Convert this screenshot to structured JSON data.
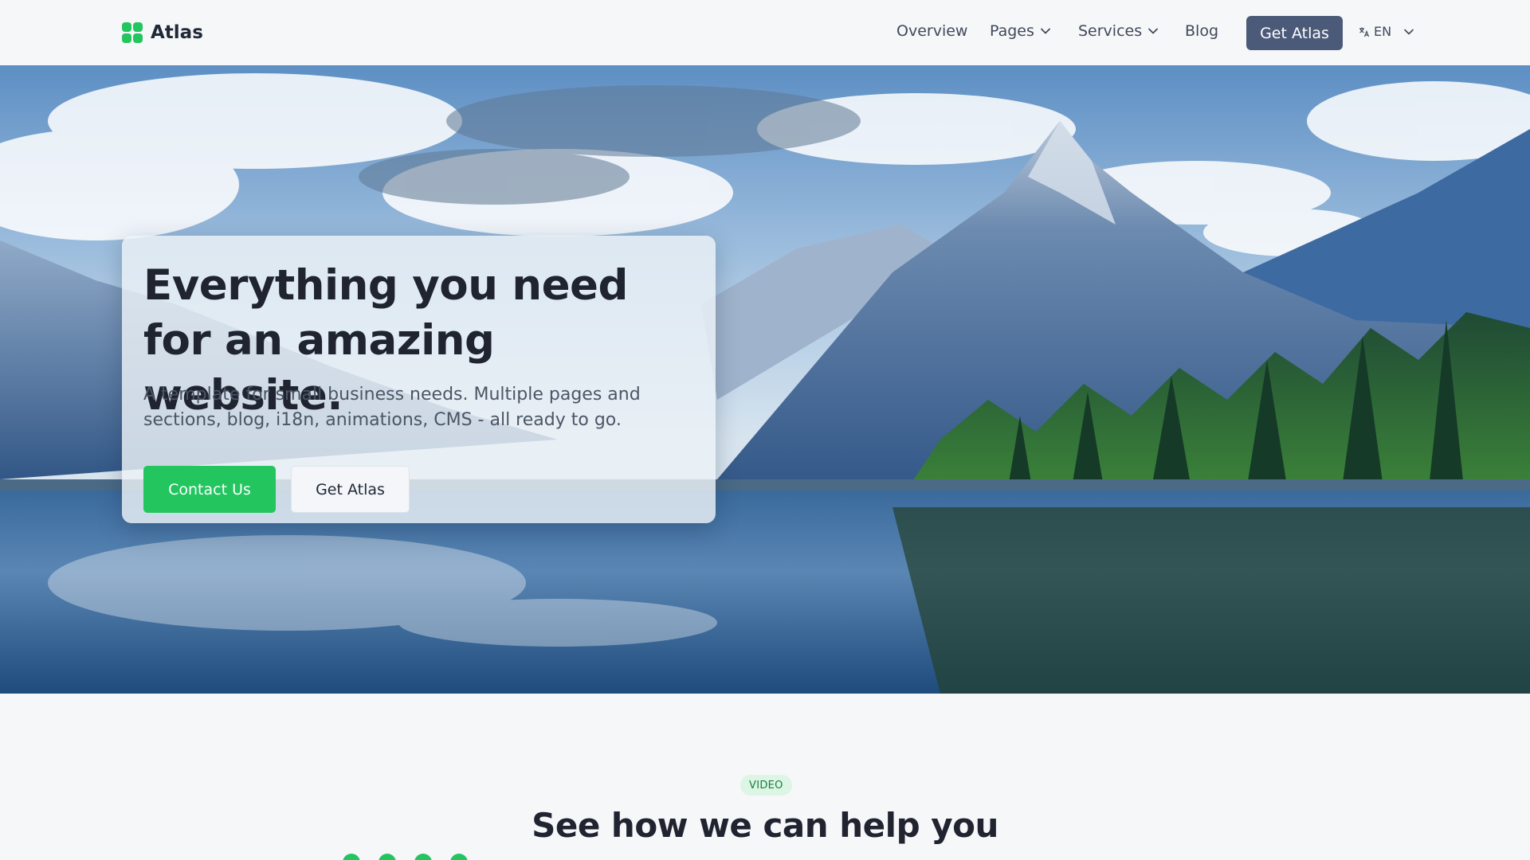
{
  "header": {
    "brand": "Atlas",
    "nav": {
      "overview": "Overview",
      "pages": "Pages",
      "services": "Services",
      "blog": "Blog",
      "cta": "Get Atlas",
      "language": "EN"
    }
  },
  "hero": {
    "title": "Everything you need for an amazing website.",
    "subtitle": "A template for small business needs. Multiple pages and sections, blog, i18n, animations, CMS - all ready to go.",
    "primary_button": "Contact Us",
    "secondary_button": "Get Atlas"
  },
  "section": {
    "badge": "VIDEO",
    "title": "See how we can help you"
  },
  "colors": {
    "accent": "#22c55e",
    "nav_button": "#4b5a78",
    "page_bg": "#f6f7f9",
    "heading": "#1f2430"
  },
  "icons": {
    "logo": "atlas-logo-icon",
    "dropdown": "chevron-down-icon",
    "language": "translate-icon"
  }
}
